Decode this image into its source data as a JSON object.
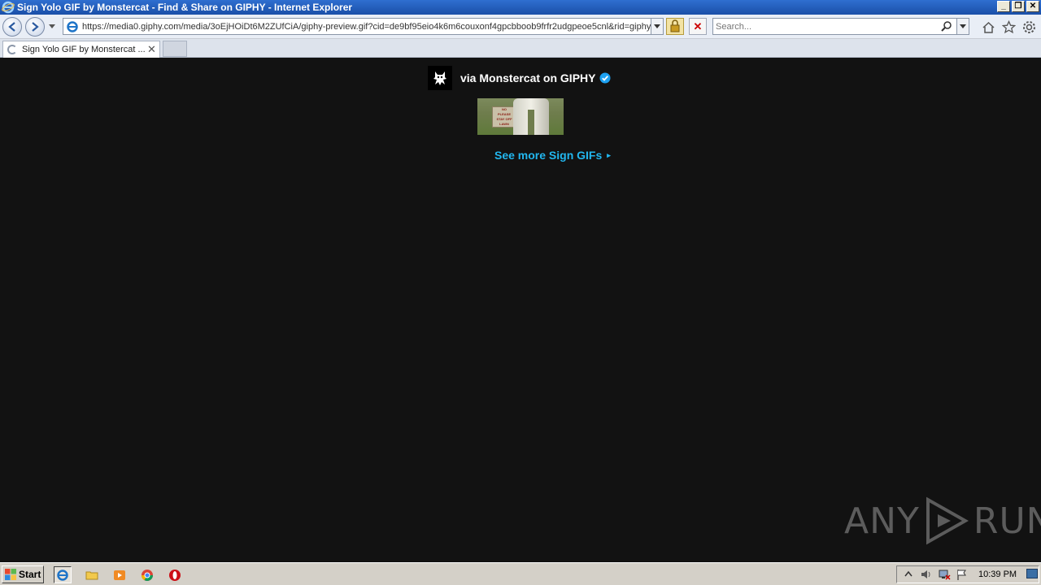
{
  "window": {
    "title": "Sign Yolo GIF by Monstercat - Find & Share on GIPHY - Internet Explorer",
    "minimize": "_",
    "restore": "❐",
    "close": "✕"
  },
  "address_bar": {
    "url": "https://media0.giphy.com/media/3oEjHOiDt6M2ZUfCiA/giphy-preview.gif?cid=de9bf95eio4k6m6couxonf4gpcbboob9frfr2udgpeoe5cnl&rid=giphy",
    "stop": "✕"
  },
  "search": {
    "placeholder": "Search..."
  },
  "tabs": [
    {
      "label": "Sign Yolo GIF by Monstercat ...",
      "close": "✕"
    }
  ],
  "content": {
    "attribution": "via Monstercat on GIPHY",
    "gif_sign_lines": [
      "NO",
      "PLEASE",
      "STAY OFF LAWN"
    ],
    "see_more": "See more Sign GIFs",
    "see_more_chevron": "▸"
  },
  "watermark": {
    "left": "ANY",
    "right": "RUN"
  },
  "taskbar": {
    "start_label": "Start",
    "clock": "10:39 PM"
  },
  "colors": {
    "page_background": "#121212",
    "link_blue": "#22b7ef",
    "verified_blue": "#1da1f2",
    "titlebar_blue": "#1a4fa8"
  }
}
